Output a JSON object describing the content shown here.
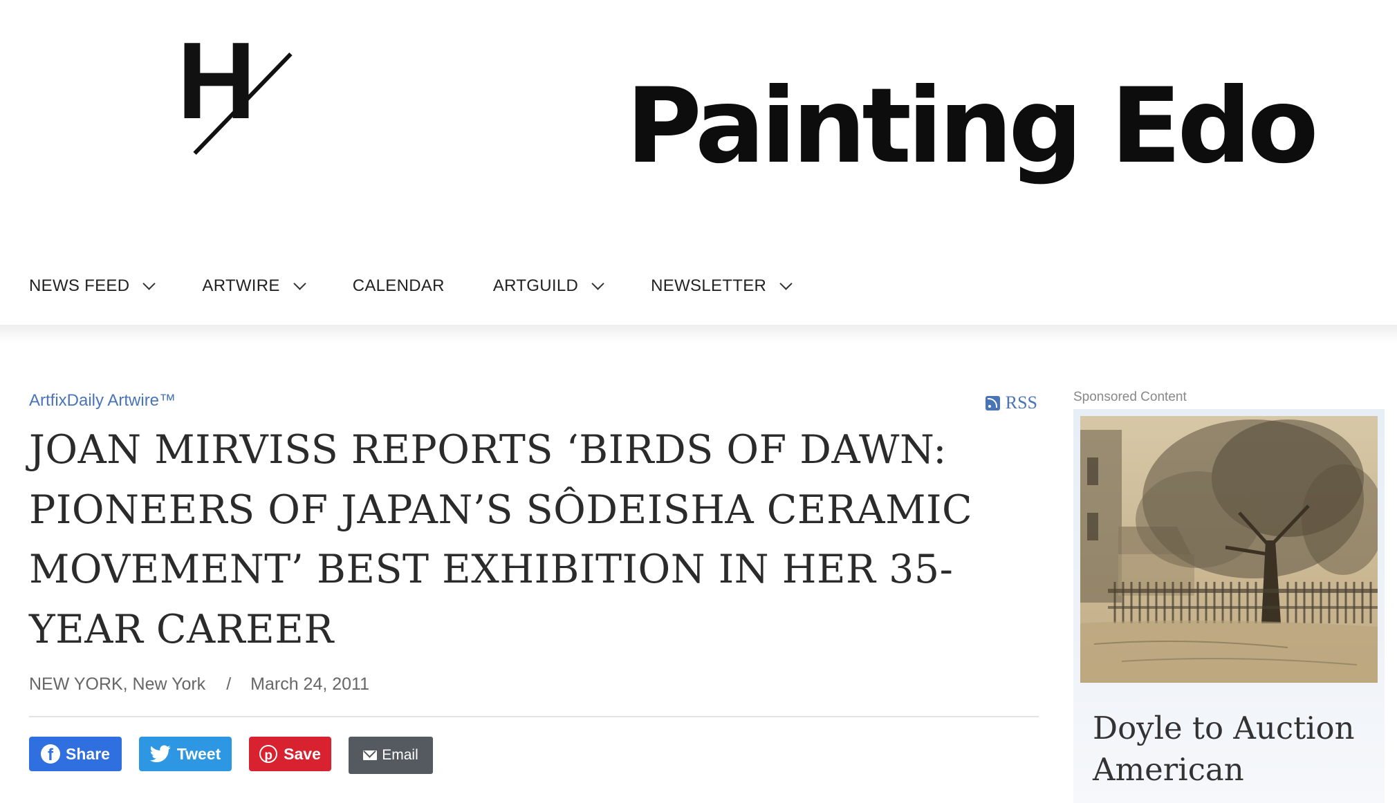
{
  "site": {
    "logo_letter": "H",
    "banner_text": "Painting Edo"
  },
  "nav": {
    "items": [
      {
        "label": "NEWS FEED",
        "has_dropdown": true
      },
      {
        "label": "ARTWIRE",
        "has_dropdown": true
      },
      {
        "label": "CALENDAR",
        "has_dropdown": false
      },
      {
        "label": "ARTGUILD",
        "has_dropdown": true
      },
      {
        "label": "NEWSLETTER",
        "has_dropdown": true
      }
    ]
  },
  "article": {
    "source": "ArtfixDaily Artwire™",
    "rss_label": "RSS",
    "headline": "JOAN MIRVISS REPORTS ‘BIRDS OF DAWN: PIONEERS OF JAPAN’S SÔDEISHA CERAMIC MOVEMENT’ BEST EXHIBITION IN HER 35-YEAR CAREER",
    "location": "NEW YORK, New York",
    "separator": "/",
    "date": "March 24, 2011"
  },
  "share": {
    "facebook_label": "Share",
    "twitter_label": "Tweet",
    "pinterest_label": "Save",
    "email_label": "Email"
  },
  "sidebar": {
    "sponsor_label": "Sponsored Content",
    "sponsor_title": "Doyle to Auction American"
  },
  "colors": {
    "link": "#4a74b8",
    "facebook": "#2f6fdf",
    "twitter": "#2d97e3",
    "pinterest": "#d9222f",
    "email": "#555a60"
  }
}
